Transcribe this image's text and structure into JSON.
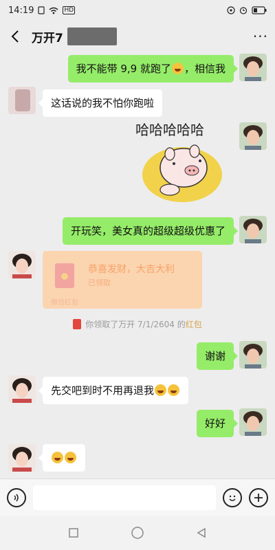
{
  "status_bar": {
    "time": "14:19",
    "icons": [
      "sim-icon",
      "wifi-icon",
      "hd-icon",
      "location-icon",
      "alarm-icon",
      "battery-icon"
    ],
    "hd_label": "HD"
  },
  "header": {
    "title": "万开7",
    "more_label": "···"
  },
  "messages": [
    {
      "side": "right",
      "text_before": "我不能带 9,9 就跑了",
      "emoji": "grin-emoji",
      "text_after": "，相信我"
    },
    {
      "side": "left",
      "text": "这话说的我不怕你跑啦"
    },
    {
      "side": "right",
      "type": "sticker",
      "sticker_text": "哈哈哈哈哈"
    },
    {
      "side": "right",
      "text": "开玩笑，美女真的超级超级优惠了"
    },
    {
      "side": "left",
      "type": "red_packet",
      "title": "恭喜发财，大吉大利",
      "status": "已领取",
      "footer": "微信红包"
    },
    {
      "side": "right",
      "text": "谢谢"
    },
    {
      "side": "left",
      "text": "先交吧到时不用再退我",
      "emoji": "grin-emoji"
    },
    {
      "side": "right",
      "text": "好好"
    },
    {
      "side": "left",
      "type": "emoji_only",
      "emoji": "laugh-cry-emoji"
    }
  ],
  "system_message": {
    "text": "你领取了万开 7/1/2604 的",
    "link": "红包"
  },
  "input_bar": {
    "placeholder": ""
  },
  "colors": {
    "background": "#ededed",
    "bubble_right": "#95ec69",
    "bubble_left": "#ffffff",
    "red_packet": "#fbd4b0"
  }
}
